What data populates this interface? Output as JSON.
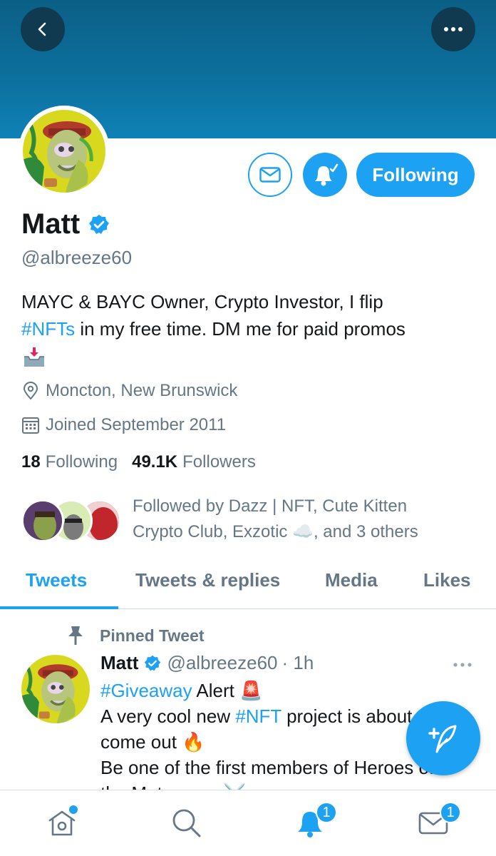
{
  "header": {
    "back_icon": "chevron-left-icon",
    "more_icon": "more-horizontal-icon",
    "banner_color": "#0d6f9d"
  },
  "profile": {
    "name": "Matt",
    "handle": "@albreeze60",
    "verified": true,
    "bio_line1": "MAYC & BAYC Owner, Crypto Investor, I flip",
    "bio_hashtag": "#NFTs",
    "bio_line2_rest": " in my free time. DM me for paid promos",
    "bio_emoji": "inbox-tray-emoji",
    "location": "Moncton, New Brunswick",
    "joined": "Joined September 2011",
    "following_count": "18",
    "following_label": "Following",
    "followers_count": "49.1K",
    "followers_label": "Followers",
    "followed_by_line1": "Followed by Dazz | NFT, Cute Kitten",
    "followed_by_line2": "Crypto Club, Exzotic ☁️, and 3 others"
  },
  "actions": {
    "message_icon": "envelope-icon",
    "notify_icon": "bell-check-icon",
    "following_label": "Following"
  },
  "tabs": [
    {
      "label": "Tweets",
      "active": true
    },
    {
      "label": "Tweets & replies",
      "active": false
    },
    {
      "label": "Media",
      "active": false
    },
    {
      "label": "Likes",
      "active": false
    }
  ],
  "pinned_tweet": {
    "pinned_label": "Pinned Tweet",
    "author": "Matt",
    "handle": "@albreeze60",
    "time": "· 1h",
    "line1_hashtag": "#Giveaway",
    "line1_rest": " Alert 🚨",
    "line2_pre": "A very cool new ",
    "line2_hashtag": "#NFT",
    "line2_rest": " project is about to",
    "line3": "come out 🔥",
    "line4": "Be one of the first members of Heroes of",
    "line5": "the Metaverse ⚔️"
  },
  "bottom_nav": {
    "items": [
      "home-icon",
      "search-icon",
      "notifications-icon",
      "messages-icon"
    ],
    "notifications_badge": "1",
    "messages_badge": "1"
  },
  "colors": {
    "accent": "#1da1f2",
    "secondary_text": "#657786",
    "primary_text": "#14171a"
  }
}
